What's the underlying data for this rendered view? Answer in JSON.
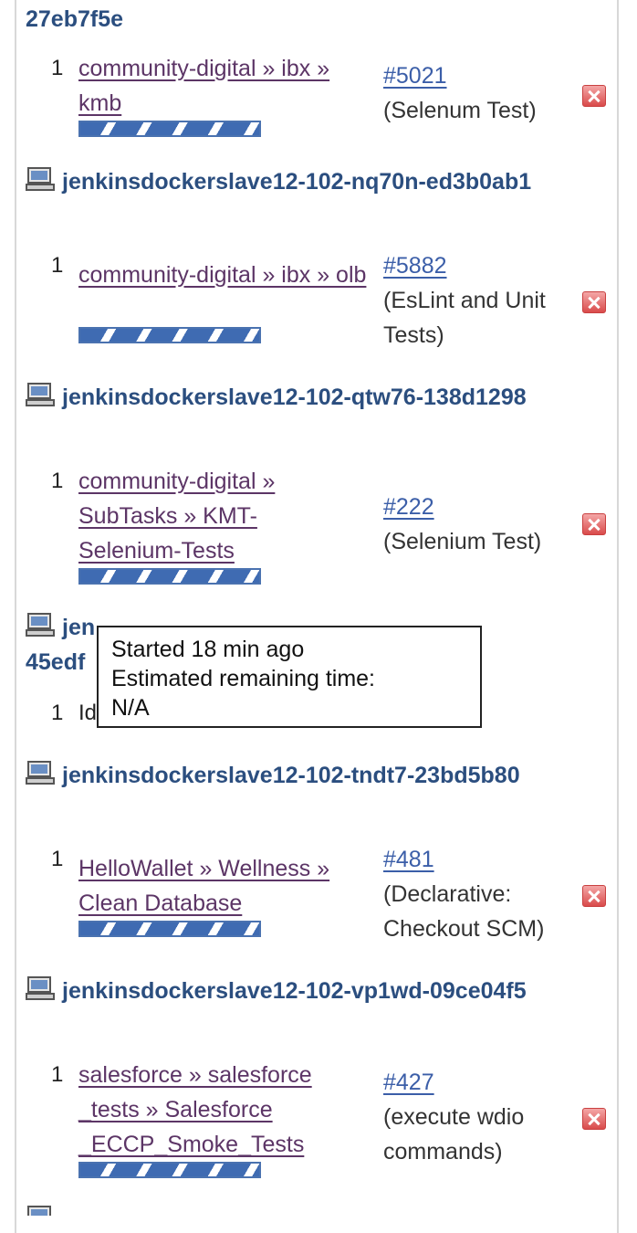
{
  "executors": [
    {
      "name": "27eb7f5e",
      "row_number": "1",
      "job": "community-digital » ibx » kmb",
      "build_number": "#5021",
      "build_stage": "(Selenum Test)"
    },
    {
      "name": "jenkinsdockerslave12-102-nq70n-ed3b0ab1",
      "row_number": "1",
      "job": "community-digital » ibx » olb",
      "build_number": "#5882",
      "build_stage": "(EsLint and Unit Tests)"
    },
    {
      "name": "jenkinsdockerslave12-102-qtw76-138d1298",
      "row_number": "1",
      "job": "community-digital » SubTasks » KMT-Selenium-Tests",
      "build_number": "#222",
      "build_stage": "(Selenium Test)"
    },
    {
      "name_visible_start": "jen",
      "name_visible_line2": "45edf",
      "row_number": "1",
      "idle_fragment": "Id"
    },
    {
      "name": "jenkinsdockerslave12-102-tndt7-23bd5b80",
      "row_number": "1",
      "job": "HelloWallet » Wellness » Clean Database",
      "build_number": "#481",
      "build_stage": "(Declarative: Checkout SCM)"
    },
    {
      "name": "jenkinsdockerslave12-102-vp1wd-09ce04f5",
      "row_number": "1",
      "job": "salesforce » salesforce _tests » Salesforce _ECCP_Smoke_Tests",
      "build_number": "#427",
      "build_stage": "(execute wdio commands)"
    }
  ],
  "tooltip": {
    "line1": "Started 18 min ago",
    "line2": "Estimated remaining time:",
    "line3": "N/A"
  },
  "icons": {
    "computer": "computer-icon",
    "stop": "stop-build-icon"
  },
  "colors": {
    "executor_name": "#2b4e7f",
    "job_link": "#5c3566",
    "build_link": "#3b5ea8",
    "progress": "#3f6bb2",
    "stop": "#d94b4b"
  }
}
